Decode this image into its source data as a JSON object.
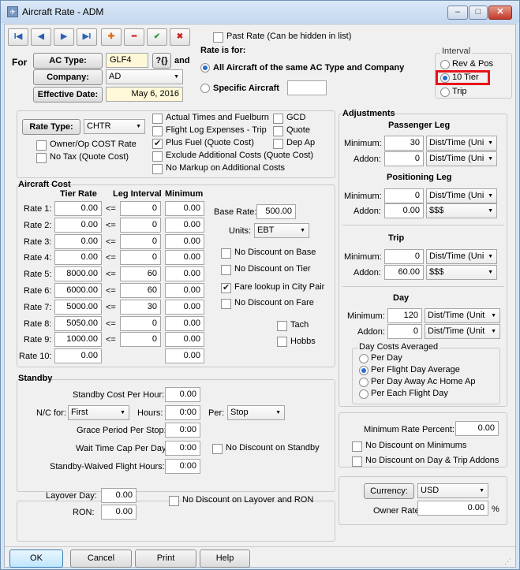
{
  "window": {
    "title": "Aircraft Rate - ADM",
    "min": "–",
    "max": "□",
    "close": "✕"
  },
  "toolbar": {
    "first": "I◀",
    "prev": "◀",
    "next": "▶",
    "last": "▶I",
    "add": "✚",
    "remove": "━",
    "accept": "✔",
    "cancel": "✖"
  },
  "past_rate": "Past Rate (Can be hidden in list)",
  "header": {
    "for": "For",
    "ac_type_btn": "AC Type:",
    "ac_type": "GLF4",
    "lookup": "?{}",
    "and": "and",
    "company_btn": "Company:",
    "company": "AD",
    "eff_btn": "Effective Date:",
    "eff_date": "May 6, 2016"
  },
  "rate_for": {
    "title": "Rate is for:",
    "all": "All Aircraft of the same AC Type and Company",
    "specific": "Specific Aircraft"
  },
  "interval": {
    "title": "Interval",
    "opt1": "Rev & Pos",
    "opt2": "10 Tier",
    "opt3": "Trip",
    "highlight": "#e8141b"
  },
  "rate_type": {
    "btn": "Rate Type:",
    "value": "CHTR",
    "owner_cost": "Owner/Op COST Rate",
    "no_tax": "No Tax (Quote Cost)",
    "actual": "Actual Times and Fuelburn",
    "flight_log": "Flight Log Expenses - Trip",
    "plus_fuel": "Plus Fuel (Quote Cost)",
    "exclude": "Exclude Additional Costs (Quote Cost)",
    "no_markup": "No Markup on Additional Costs",
    "gcd": "GCD",
    "quote": "Quote",
    "dep_ap": "Dep Ap"
  },
  "aircraft_cost": {
    "title": "Aircraft Cost",
    "h_tier": "Tier Rate",
    "h_leg": "Leg Interval",
    "h_min": "Minimum",
    "rows": [
      {
        "label": "Rate 1:",
        "tier": "0.00",
        "le": "<=",
        "leg": "0",
        "min": "0.00"
      },
      {
        "label": "Rate 2:",
        "tier": "0.00",
        "le": "<=",
        "leg": "0",
        "min": "0.00"
      },
      {
        "label": "Rate 3:",
        "tier": "0.00",
        "le": "<=",
        "leg": "0",
        "min": "0.00"
      },
      {
        "label": "Rate 4:",
        "tier": "0.00",
        "le": "<=",
        "leg": "0",
        "min": "0.00"
      },
      {
        "label": "Rate 5:",
        "tier": "8000.00",
        "le": "<=",
        "leg": "60",
        "min": "0.00"
      },
      {
        "label": "Rate 6:",
        "tier": "6000.00",
        "le": "<=",
        "leg": "60",
        "min": "0.00"
      },
      {
        "label": "Rate 7:",
        "tier": "5000.00",
        "le": "<=",
        "leg": "30",
        "min": "0.00"
      },
      {
        "label": "Rate 8:",
        "tier": "5050.00",
        "le": "<=",
        "leg": "0",
        "min": "0.00"
      },
      {
        "label": "Rate 9:",
        "tier": "1000.00",
        "le": "<=",
        "leg": "0",
        "min": "0.00"
      },
      {
        "label": "Rate 10:",
        "tier": "0.00",
        "min": "0.00"
      }
    ],
    "base_rate_lbl": "Base Rate:",
    "base_rate": "500.00",
    "units_lbl": "Units:",
    "units": "EBT",
    "no_disc_base": "No Discount on Base",
    "no_disc_tier": "No Discount on Tier",
    "fare_lookup": "Fare lookup in City Pair",
    "no_disc_fare": "No Discount on Fare",
    "tach": "Tach",
    "hobbs": "Hobbs"
  },
  "standby": {
    "title": "Standby",
    "cost_lbl": "Standby Cost Per Hour:",
    "cost": "0.00",
    "nc_lbl": "N/C for:",
    "nc": "First",
    "hours_lbl": "Hours:",
    "hours": "0:00",
    "per_lbl": "Per:",
    "per": "Stop",
    "grace_lbl": "Grace Period Per Stop:",
    "grace": "0:00",
    "wait_lbl": "Wait Time Cap Per Day:",
    "wait": "0:00",
    "no_disc": "No Discount on Standby",
    "waived_lbl": "Standby-Waived Flight Hours:",
    "waived": "0:00"
  },
  "layover": {
    "day_lbl": "Layover Day:",
    "day": "0.00",
    "ron_lbl": "RON:",
    "ron": "0.00",
    "no_disc": "No Discount on Layover and RON"
  },
  "adjustments": {
    "title": "Adjustments",
    "pass": "Passenger Leg",
    "pos": "Positioning Leg",
    "trip": "Trip",
    "day": "Day",
    "min_lbl": "Minimum:",
    "addon_lbl": "Addon:",
    "pass_min": "30",
    "pass_min_unit": "Dist/Time (Uni",
    "pass_add": "0",
    "pass_add_unit": "Dist/Time (Uni",
    "pos_min": "0",
    "pos_min_unit": "Dist/Time (Uni",
    "pos_add": "0.00",
    "pos_add_unit": "$$$",
    "trip_min": "0",
    "trip_min_unit": "Dist/Time (Uni",
    "trip_add": "60.00",
    "trip_add_unit": "$$$",
    "day_min": "120",
    "day_min_unit": "Dist/Time (Unit",
    "day_add": "0",
    "day_add_unit": "Dist/Time (Unit",
    "dca_title": "Day Costs Averaged",
    "dca1": "Per Day",
    "dca2": "Per Flight Day Average",
    "dca3": "Per Day Away Ac Home Ap",
    "dca4": "Per Each Flight Day"
  },
  "min_rate": {
    "lbl": "Minimum Rate Percent:",
    "val": "0.00",
    "no_disc_min": "No Discount on Minimums",
    "no_disc_day": "No Discount on Day & Trip Addons"
  },
  "currency": {
    "btn": "Currency:",
    "val": "USD",
    "owner_lbl": "Owner Rate:",
    "owner": "0.00",
    "pct": "%"
  },
  "footer": {
    "ok": "OK",
    "cancel": "Cancel",
    "print": "Print",
    "help": "Help"
  }
}
